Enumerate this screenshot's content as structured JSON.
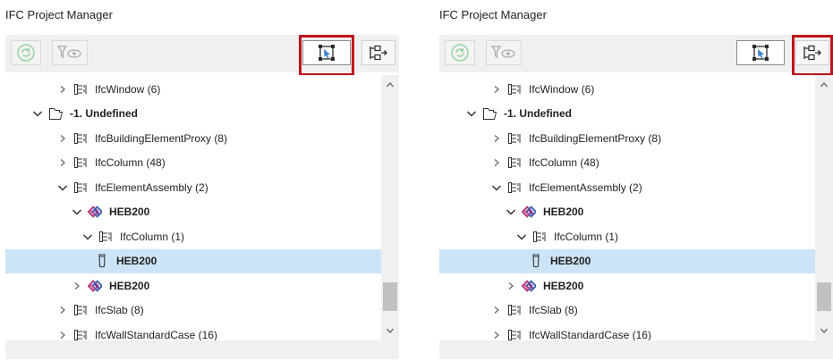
{
  "panels": [
    {
      "title": "IFC Project Manager",
      "highlighted_button": "select-in-model",
      "tree_rows": [
        {
          "label": "IfcWindow (6)",
          "level": 2,
          "chevron": "right",
          "icon": "ifc-class-icon",
          "bold": false,
          "selected": false
        },
        {
          "label": "-1. Undefined",
          "level": 1,
          "chevron": "down",
          "icon": "storey-folder-icon",
          "bold": true,
          "selected": false
        },
        {
          "label": "IfcBuildingElementProxy (8)",
          "level": 2,
          "chevron": "right",
          "icon": "ifc-class-icon",
          "bold": false,
          "selected": false
        },
        {
          "label": "IfcColumn (48)",
          "level": 2,
          "chevron": "right",
          "icon": "ifc-class-icon",
          "bold": false,
          "selected": false
        },
        {
          "label": "IfcElementAssembly (2)",
          "level": 2,
          "chevron": "down",
          "icon": "ifc-class-icon",
          "bold": false,
          "selected": false
        },
        {
          "label": "HEB200",
          "level": 3,
          "chevron": "down",
          "icon": "assembly-icon",
          "bold": true,
          "selected": false
        },
        {
          "label": "IfcColumn (1)",
          "level": 4,
          "chevron": "down",
          "icon": "ifc-class-icon",
          "bold": false,
          "selected": false
        },
        {
          "label": "HEB200",
          "level": 5,
          "chevron": "none",
          "icon": "column-element-icon",
          "bold": true,
          "selected": true
        },
        {
          "label": "HEB200",
          "level": 3,
          "chevron": "right",
          "icon": "assembly-icon",
          "bold": true,
          "selected": false
        },
        {
          "label": "IfcSlab (8)",
          "level": 2,
          "chevron": "right",
          "icon": "ifc-class-icon",
          "bold": false,
          "selected": false
        },
        {
          "label": "IfcWallStandardCase (16)",
          "level": 2,
          "chevron": "right",
          "icon": "ifc-class-icon",
          "bold": false,
          "selected": false
        }
      ]
    },
    {
      "title": "IFC Project Manager",
      "highlighted_button": "select-in-tree",
      "tree_rows": [
        {
          "label": "IfcWindow (6)",
          "level": 2,
          "chevron": "right",
          "icon": "ifc-class-icon",
          "bold": false,
          "selected": false
        },
        {
          "label": "-1. Undefined",
          "level": 1,
          "chevron": "down",
          "icon": "storey-folder-icon",
          "bold": true,
          "selected": false
        },
        {
          "label": "IfcBuildingElementProxy (8)",
          "level": 2,
          "chevron": "right",
          "icon": "ifc-class-icon",
          "bold": false,
          "selected": false
        },
        {
          "label": "IfcColumn (48)",
          "level": 2,
          "chevron": "right",
          "icon": "ifc-class-icon",
          "bold": false,
          "selected": false
        },
        {
          "label": "IfcElementAssembly (2)",
          "level": 2,
          "chevron": "down",
          "icon": "ifc-class-icon",
          "bold": false,
          "selected": false
        },
        {
          "label": "HEB200",
          "level": 3,
          "chevron": "down",
          "icon": "assembly-icon",
          "bold": true,
          "selected": false
        },
        {
          "label": "IfcColumn (1)",
          "level": 4,
          "chevron": "down",
          "icon": "ifc-class-icon",
          "bold": false,
          "selected": false
        },
        {
          "label": "HEB200",
          "level": 5,
          "chevron": "none",
          "icon": "column-element-icon",
          "bold": true,
          "selected": true
        },
        {
          "label": "HEB200",
          "level": 3,
          "chevron": "right",
          "icon": "assembly-icon",
          "bold": true,
          "selected": false
        },
        {
          "label": "IfcSlab (8)",
          "level": 2,
          "chevron": "right",
          "icon": "ifc-class-icon",
          "bold": false,
          "selected": false
        },
        {
          "label": "IfcWallStandardCase (16)",
          "level": 2,
          "chevron": "right",
          "icon": "ifc-class-icon",
          "bold": false,
          "selected": false
        }
      ]
    }
  ],
  "toolbar_icons": [
    "refresh-icon",
    "filter-icon",
    "select-in-model-icon",
    "select-in-tree-icon"
  ],
  "colors": {
    "highlight": "#c0131a",
    "selection": "#cce4f7",
    "toolbar_bg": "#f0f0f0",
    "disabled_icon": "#8fcf99"
  }
}
